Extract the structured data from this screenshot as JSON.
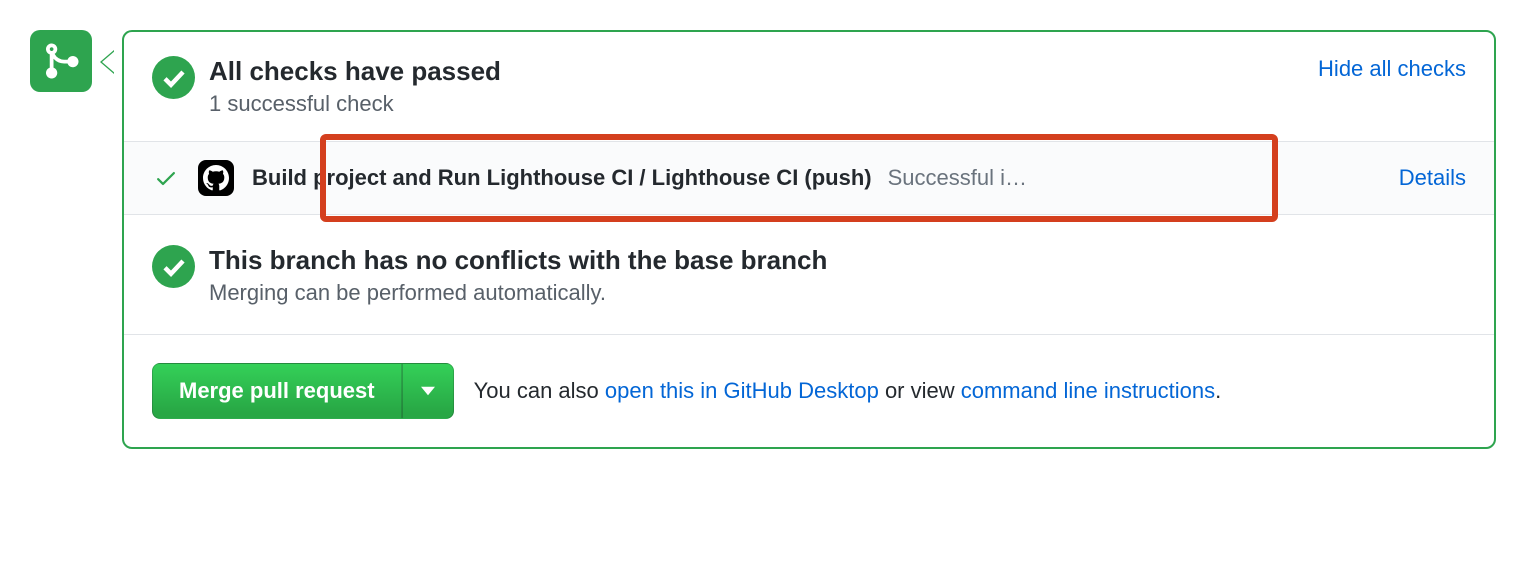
{
  "checks": {
    "title": "All checks have passed",
    "subtitle": "1 successful check",
    "toggle_link": "Hide all checks",
    "items": [
      {
        "name": "Build project and Run Lighthouse CI / Lighthouse CI (push)",
        "status": "Successful i…",
        "details_link": "Details"
      }
    ]
  },
  "conflicts": {
    "title": "This branch has no conflicts with the base branch",
    "subtitle": "Merging can be performed automatically."
  },
  "merge": {
    "button_label": "Merge pull request",
    "footer_prefix": "You can also ",
    "desktop_link": "open this in GitHub Desktop",
    "footer_mid": " or view ",
    "cli_link": "command line instructions",
    "footer_suffix": "."
  }
}
